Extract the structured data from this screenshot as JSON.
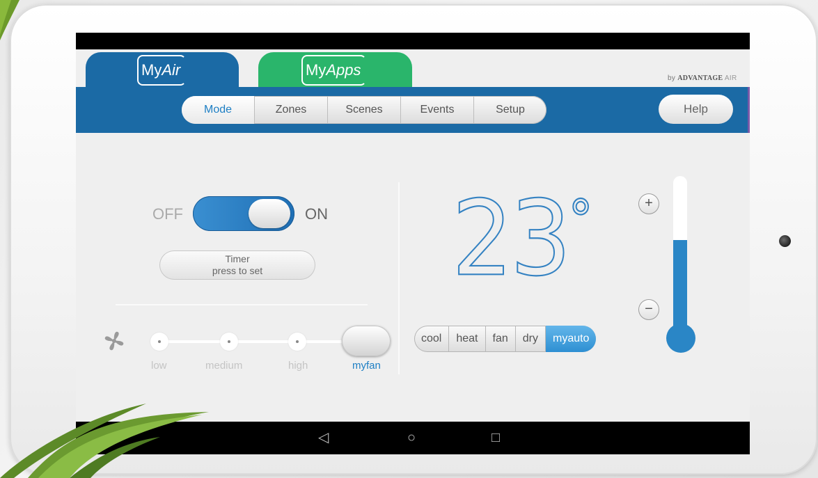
{
  "tabs": {
    "myair": {
      "my": "My",
      "name": "Air"
    },
    "myapps": {
      "my": "My",
      "name": "Apps"
    }
  },
  "brand": {
    "by": "by",
    "name": "ADVANTAGE",
    "suffix": "AIR"
  },
  "nav": {
    "items": [
      "Mode",
      "Zones",
      "Scenes",
      "Events",
      "Setup"
    ],
    "active": "Mode",
    "help": "Help"
  },
  "power": {
    "off_label": "OFF",
    "on_label": "ON",
    "state": "on"
  },
  "timer": {
    "line1": "Timer",
    "line2": "press to set"
  },
  "fan": {
    "icon": "fan-icon",
    "speeds": [
      "low",
      "medium",
      "high",
      "myfan"
    ],
    "selected": "myfan"
  },
  "temperature": {
    "value": "23",
    "unit": "°",
    "level": 0.6
  },
  "modes": {
    "items": [
      "cool",
      "heat",
      "fan",
      "dry",
      "myauto"
    ],
    "active": "myauto"
  },
  "controls": {
    "plus": "+",
    "minus": "−"
  },
  "system_nav": {
    "back": "◁",
    "home": "○",
    "recents": "□"
  },
  "colors": {
    "blue": "#1b6aa5",
    "green": "#2ab56b",
    "accent": "#1e7fc4"
  }
}
